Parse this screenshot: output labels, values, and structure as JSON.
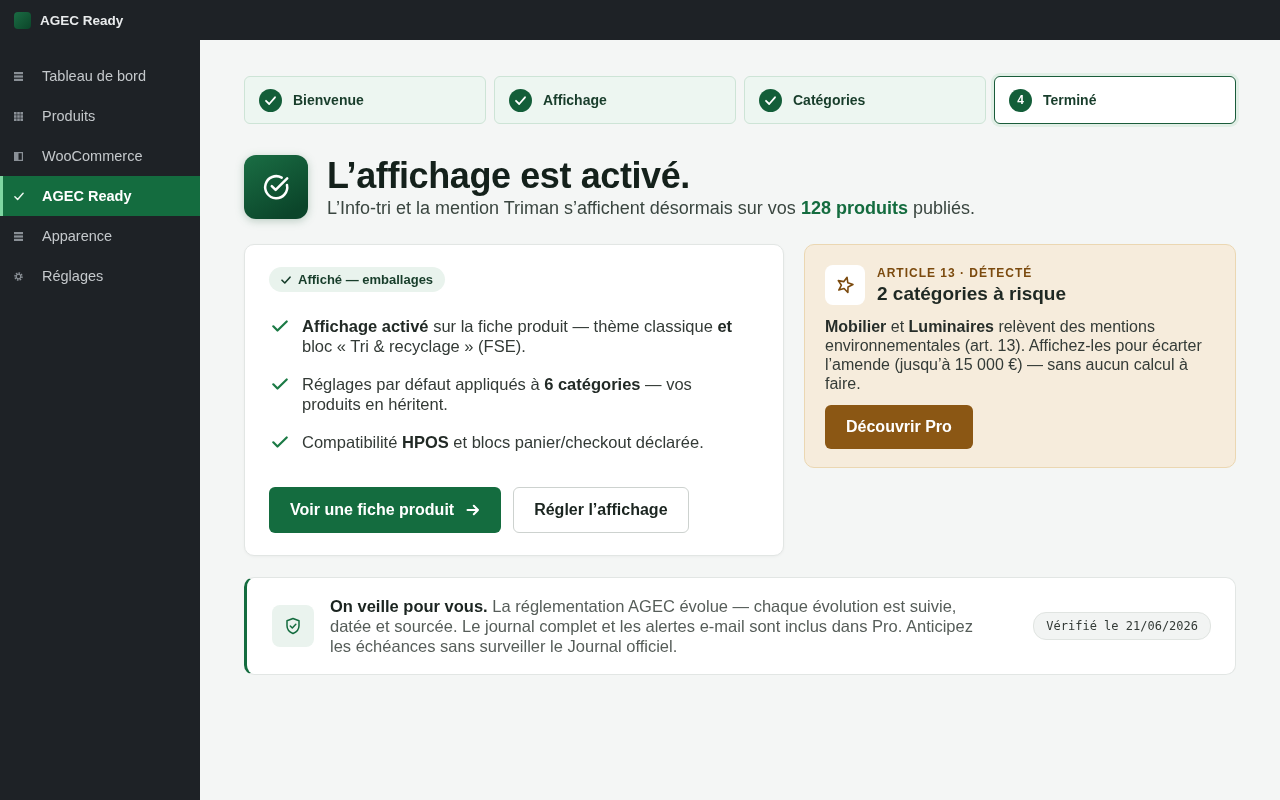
{
  "app": {
    "title": "AGEC Ready"
  },
  "sidebar": {
    "items": [
      {
        "label": "Tableau de bord",
        "selected": false
      },
      {
        "label": "Produits",
        "selected": false
      },
      {
        "label": "WooCommerce",
        "selected": false
      },
      {
        "label": "AGEC Ready",
        "selected": true
      },
      {
        "label": "Apparence",
        "selected": false
      },
      {
        "label": "Réglages",
        "selected": false
      }
    ]
  },
  "steps": [
    {
      "label": "Bienvenue",
      "done": true,
      "selected": false
    },
    {
      "label": "Affichage",
      "done": true,
      "selected": false
    },
    {
      "label": "Catégories",
      "done": true,
      "selected": false
    },
    {
      "label": "Terminé",
      "number": "4",
      "done": false,
      "selected": true
    }
  ],
  "header": {
    "title": "L’affichage est activé.",
    "subtitle": "L’Info-tri et la mention Triman s’affichent désormais sur vos **128 produits** publiés."
  },
  "summary_card": {
    "tag": "Affiché — emballages",
    "items": [
      "**Affichage activé** sur la fiche produit — thème classique **et** bloc « Tri & recyclage » (FSE).",
      "Réglages par défaut appliqués à **6 catégories** — vos produits en héritent.",
      "Compatibilité **HPOS** et blocs panier/checkout déclarée."
    ],
    "buttons": [
      {
        "label": "Voir une fiche produit",
        "kind": "primary"
      },
      {
        "label": "Régler l’affichage",
        "kind": "secondary"
      }
    ]
  },
  "pro_card": {
    "eyebrow": "ARTICLE 13 · DÉTECTÉ",
    "title": "2 catégories à risque",
    "text": "**Mobilier** et **Luminaires** relèvent des mentions environnementales (art. 13). Affichez-les pour écarter l’amende (jusqu’à 15 000 €) — sans aucun calcul à faire.",
    "button": "Découvrir Pro"
  },
  "watch_banner": {
    "text": "**On veille pour vous.** La réglementation AGEC évolue — chaque évolution est suivie, datée et sourcée. Le journal complet et les alertes e-mail sont inclus dans Pro. Anticipez les échéances sans surveiller le Journal officiel.",
    "date_tag": "Vérifié le 21/06/2026"
  }
}
